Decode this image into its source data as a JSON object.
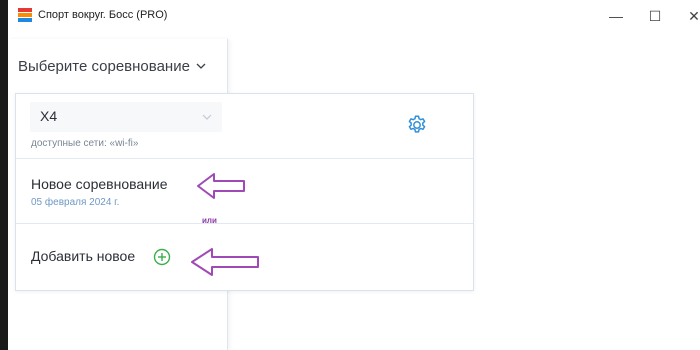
{
  "window": {
    "title": "Спорт вокруг. Босс (PRO)",
    "minimize_glyph": "—",
    "maximize_glyph": "☐",
    "close_glyph": "✕"
  },
  "sidebar": {
    "competition_select_label": "Выберите соревнование"
  },
  "panel": {
    "device": {
      "name": "X4",
      "networks_text": "доступные сети: «wi-fi»",
      "settings_icon": "gear-icon"
    },
    "competition": {
      "name": "Новое соревнование",
      "date": "05 февраля 2024 г."
    },
    "or_text": "или",
    "add_new_label": "Добавить новое",
    "add_icon": "plus-circle-icon"
  },
  "colors": {
    "accent_blue": "#2f8fd8",
    "add_green": "#3aae4a",
    "annotation_purple": "#a04ab8",
    "date_blue": "#6f98c4"
  }
}
